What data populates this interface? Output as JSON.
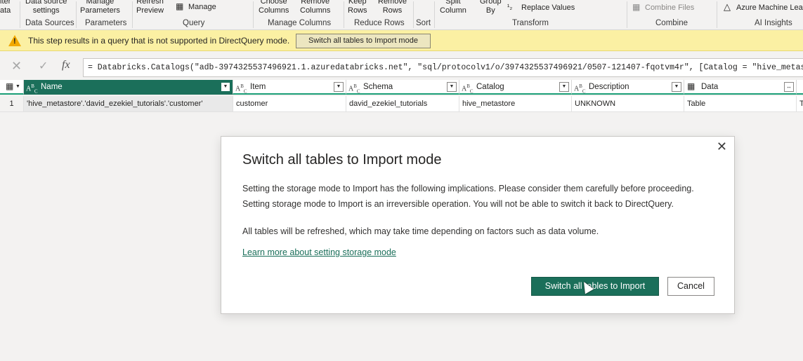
{
  "ribbon": {
    "items": [
      {
        "label": "iter\nata"
      },
      {
        "label": "Data source\nsettings"
      },
      {
        "label": "Manage\nParameters"
      },
      {
        "label": "Refresh\nPreview"
      },
      {
        "label": "Manage"
      },
      {
        "label": "Choose\nColumns"
      },
      {
        "label": "Remove\nColumns"
      },
      {
        "label": "Keep\nRows"
      },
      {
        "label": "Remove\nRows"
      },
      {
        "label": "Split\nColumn"
      },
      {
        "label": "Group\nBy"
      },
      {
        "label": "Replace Values"
      },
      {
        "label": "Combine Files"
      },
      {
        "label": "Azure Machine Lea"
      }
    ],
    "groups": [
      "Data Sources",
      "Parameters",
      "Query",
      "Manage Columns",
      "Reduce Rows",
      "Sort",
      "Transform",
      "Combine",
      "AI Insights"
    ]
  },
  "warning": {
    "text": "This step results in a query that is not supported in DirectQuery mode.",
    "button": "Switch all tables to Import mode"
  },
  "formula": {
    "text": "= Databricks.Catalogs(\"adb-3974325537496921.1.azuredatabricks.net\", \"sql/protocolv1/o/3974325537496921/0507-121407-fqotvm4r\", [Catalog = \"hive_metastore\","
  },
  "table": {
    "columns": [
      {
        "name": "Name",
        "type": "ABC"
      },
      {
        "name": "Item",
        "type": "ABC"
      },
      {
        "name": "Schema",
        "type": "ABC"
      },
      {
        "name": "Catalog",
        "type": "ABC"
      },
      {
        "name": "Description",
        "type": "ABC"
      },
      {
        "name": "Data",
        "type": "table"
      }
    ],
    "rows": [
      {
        "num": "1",
        "cells": [
          "'hive_metastore'.'david_ezekiel_tutorials'.'customer'",
          "customer",
          "david_ezekiel_tutorials",
          "hive_metastore",
          "UNKNOWN",
          "Table",
          "T"
        ]
      }
    ]
  },
  "dialog": {
    "title": "Switch all tables to Import mode",
    "para1_line1": "Setting the storage mode to Import has the following implications. Please consider them carefully before proceeding.",
    "para1_line2": "Setting storage mode to Import is an irreversible operation.  You will not be able to switch it back to DirectQuery.",
    "para2": "All tables will be refreshed, which may take time depending on factors such as data volume.",
    "link": "Learn more about setting storage mode",
    "primary_button": "Switch all tables to Import",
    "cancel_button": "Cancel"
  },
  "colors": {
    "accent": "#1b6f5a",
    "header_underline": "#1b9e77",
    "warning_bg": "#fbf0a3"
  }
}
